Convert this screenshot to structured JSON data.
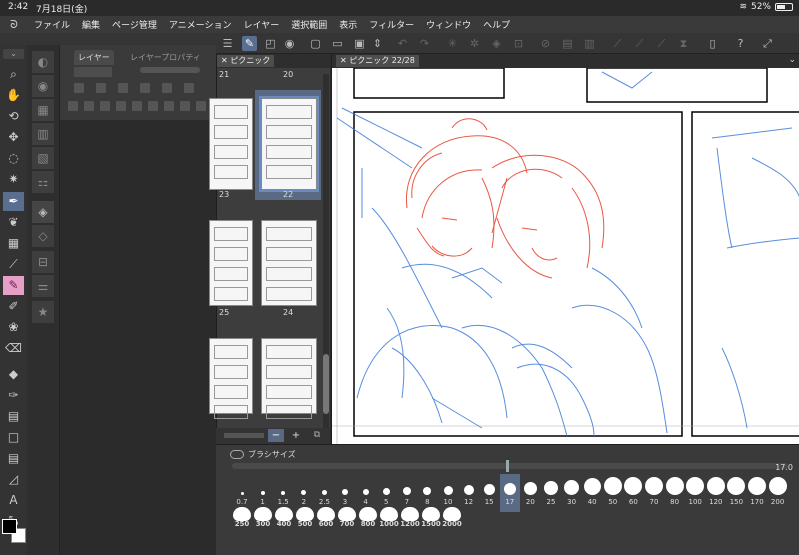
{
  "status": {
    "time": "2:42",
    "date": "7月18日(金)",
    "battery": "52%"
  },
  "menu": [
    "ファイル",
    "編集",
    "ページ管理",
    "アニメーション",
    "レイヤー",
    "選択範囲",
    "表示",
    "フィルター",
    "ウィンドウ",
    "ヘルプ"
  ],
  "layer_panel": {
    "tab_layer": "レイヤー",
    "tab_property": "レイヤープロパティ"
  },
  "page_manager": {
    "tab": "ピクニック",
    "top_number": "20",
    "top_partial": "21",
    "pages": [
      {
        "number": "23"
      },
      {
        "number": "22",
        "selected": true
      },
      {
        "number": "25"
      },
      {
        "number": "24"
      }
    ],
    "zoom_minus": "−",
    "zoom_plus": "+"
  },
  "canvas": {
    "tab": "ピクニック 22/28"
  },
  "brush_panel": {
    "title": "ブラシサイズ",
    "value": "17.0",
    "sizes_row1": [
      "0.7",
      "1",
      "1.5",
      "2",
      "2.5",
      "3",
      "4",
      "5",
      "7",
      "8",
      "10",
      "12",
      "15",
      "17",
      "20",
      "25",
      "30",
      "40",
      "50",
      "60",
      "70",
      "80",
      "100",
      "120",
      "150",
      "170",
      "200"
    ],
    "selected": "17",
    "sizes_row2": [
      "250",
      "300",
      "400",
      "500",
      "600",
      "700",
      "800",
      "1000",
      "1200",
      "1500",
      "2000"
    ]
  },
  "colors": {
    "accent": "#5a6e90",
    "main_color": "#000000",
    "sub_color": "#ffffff",
    "sketch_red": "#e8452e",
    "sketch_blue": "#3a7ad8"
  }
}
